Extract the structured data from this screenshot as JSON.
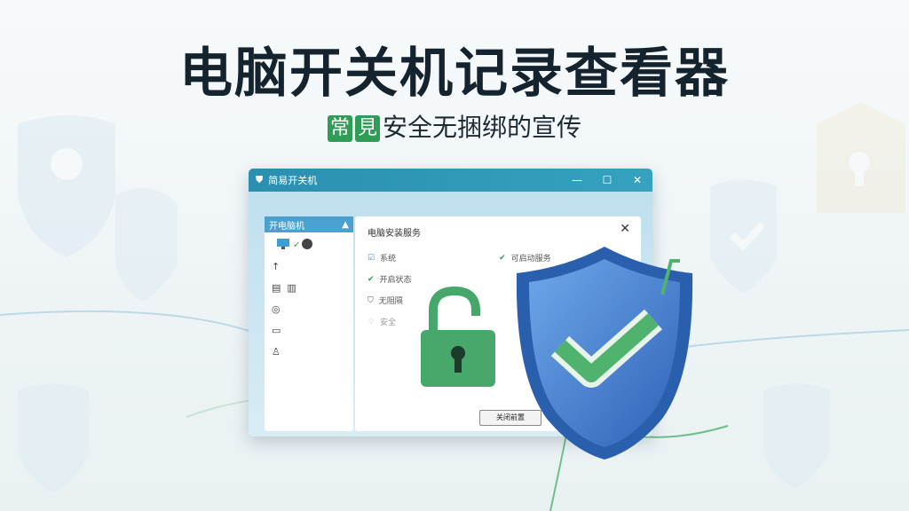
{
  "heading": {
    "title": "电脑开关机记录查看器",
    "badge_left": "常",
    "badge_right": "見",
    "subtitle_rest": "安全无捆绑的宣传"
  },
  "window": {
    "title": "简易开关机",
    "controls": {
      "minimize": "—",
      "maximize": "☐",
      "close": "✕"
    },
    "sidebar": {
      "header": "开电脑机",
      "header_chevron": "▲",
      "icons": [
        "monitor-icon",
        "arrow-up-icon",
        "document-icon",
        "settings-icon",
        "folder-icon",
        "user-icon"
      ]
    },
    "panel": {
      "title": "电脑安装服务",
      "rows": [
        {
          "label": "系统",
          "status": "可启动服务"
        },
        {
          "label": "开启状态"
        },
        {
          "label": "无阻隔"
        },
        {
          "label": "安全"
        }
      ],
      "button": "关闭前置",
      "close": "✕"
    }
  },
  "colors": {
    "accent": "#2f9d55",
    "shield": "#3f7fcf",
    "titlebar": "#2b8fb0"
  }
}
